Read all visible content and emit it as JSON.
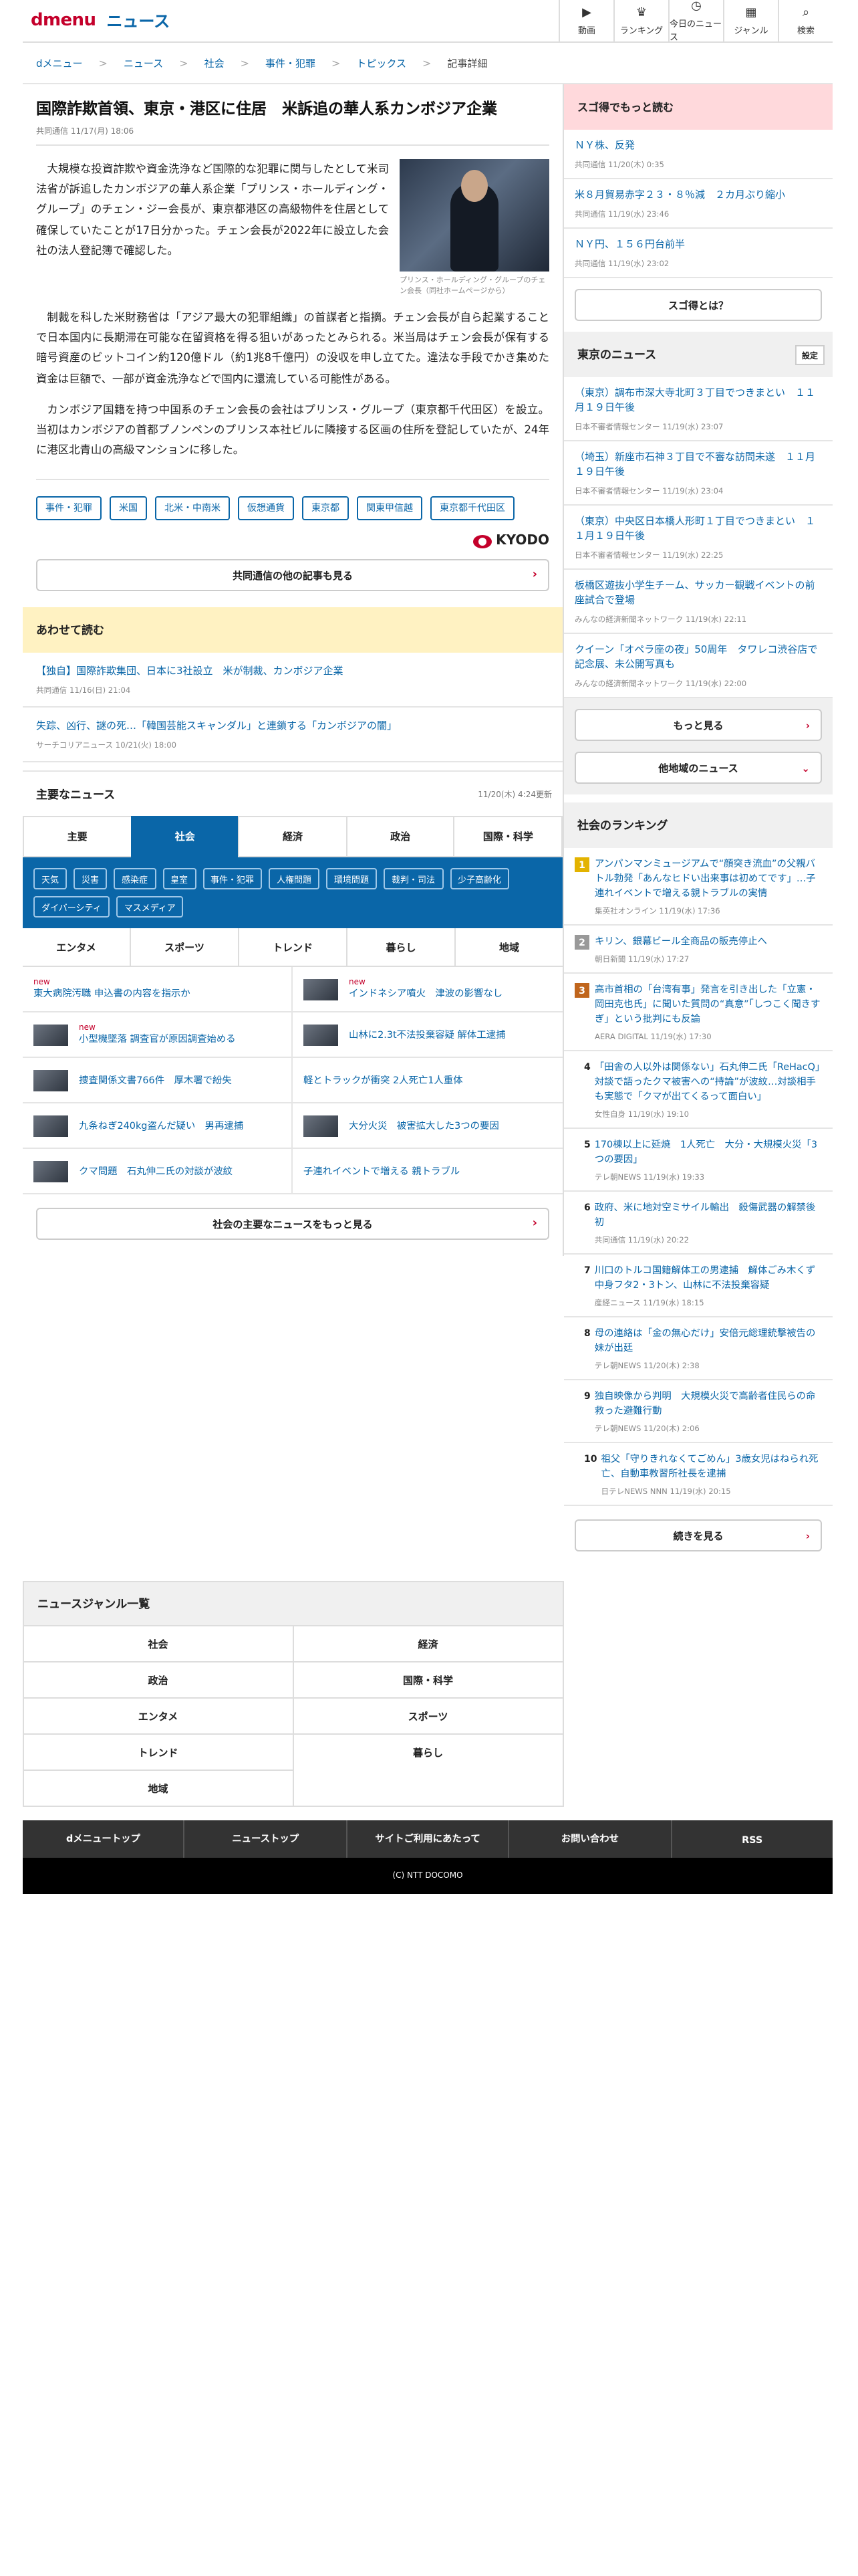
{
  "header": {
    "logo": "dmenu",
    "site": "ニュース",
    "nav": [
      {
        "icon": "▶",
        "label": "動画"
      },
      {
        "icon": "♛",
        "label": "ランキング"
      },
      {
        "icon": "◷",
        "label": "今日のニュース"
      },
      {
        "icon": "▦",
        "label": "ジャンル"
      },
      {
        "icon": "⌕",
        "label": "検索"
      }
    ]
  },
  "breadcrumb": [
    "dメニュー",
    "ニュース",
    "社会",
    "事件・犯罪",
    "トピックス",
    "記事詳細"
  ],
  "article": {
    "title": "国際詐欺首領、東京・港区に住居　米訴追の華人系カンボジア企業",
    "meta": "共同通信 11/17(月) 18:06",
    "p1": "大規模な投資詐欺や資金洗浄など国際的な犯罪に関与したとして米司法省が訴追したカンボジアの華人系企業「プリンス・ホールディング・グループ」のチェン・ジー会長が、東京都港区の高級物件を住居として確保していたことが17日分かった。チェン会長が2022年に設立した会社の法人登記簿で確認した。",
    "caption": "プリンス・ホールディング・グループのチェン会長（同社ホームページから）",
    "p2": "制裁を科した米財務省は「アジア最大の犯罪組織」の首謀者と指摘。チェン会長が自ら起業することで日本国内に長期滞在可能な在留資格を得る狙いがあったとみられる。米当局はチェン会長が保有する暗号資産のビットコイン約120億ドル（約1兆8千億円）の没収を申し立てた。違法な手段でかき集めた資金は巨額で、一部が資金洗浄などで国内に還流している可能性がある。",
    "p3": "カンボジア国籍を持つ中国系のチェン会長の会社はプリンス・グループ（東京都千代田区）を設立。当初はカンボジアの首都プノンペンのプリンス本社ビルに隣接する区画の住所を登記していたが、24年に港区北青山の高級マンションに移した。",
    "tags": [
      "事件・犯罪",
      "米国",
      "北米・中南米",
      "仮想通貨",
      "東京都",
      "関東甲信越",
      "東京都千代田区"
    ],
    "provider": "KYODO",
    "more_btn": "共同通信の他の記事も見る"
  },
  "related": {
    "title": "あわせて読む",
    "items": [
      {
        "t": "【独自】国際詐欺集団、日本に3社設立　米が制裁、カンボジア企業",
        "m": "共同通信 11/16(日) 21:04"
      },
      {
        "t": "失踪、凶行、謎の死…「韓国芸能スキャンダル」と連鎖する「カンボジアの闇」",
        "m": "サーチコリアニュース 10/21(火) 18:00"
      }
    ]
  },
  "mainnews": {
    "title": "主要なニュース",
    "updated": "11/20(木) 4:24更新",
    "tabs": [
      "主要",
      "社会",
      "経済",
      "政治",
      "国際・科学"
    ],
    "subtags": [
      "天気",
      "災害",
      "感染症",
      "皇室",
      "事件・犯罪",
      "人権問題",
      "環境問題",
      "裁判・司法",
      "少子高齢化",
      "ダイバーシティ",
      "マスメディア"
    ],
    "gtabs": [
      "エンタメ",
      "スポーツ",
      "トレンド",
      "暮らし",
      "地域"
    ],
    "items": [
      {
        "t": "東大病院汚職 申込書の内容を指示か",
        "new": "new",
        "th": false
      },
      {
        "t": "インドネシア噴火　津波の影響なし",
        "new": "new",
        "th": true
      },
      {
        "t": "小型機墜落 調査官が原因調査始める",
        "new": "new",
        "th": true
      },
      {
        "t": "山林に2.3t不法投棄容疑 解体工逮捕",
        "new": "",
        "th": true
      },
      {
        "t": "捜査関係文書766件　厚木署で紛失",
        "new": "",
        "th": true
      },
      {
        "t": "軽とトラックが衝突 2人死亡1人重体",
        "new": "",
        "th": false
      },
      {
        "t": "九条ねぎ240kg盗んだ疑い　男再逮捕",
        "new": "",
        "th": true
      },
      {
        "t": "大分火災　被害拡大した3つの要因",
        "new": "",
        "th": true
      },
      {
        "t": "クマ問題　石丸伸二氏の対談が波紋",
        "new": "",
        "th": true
      },
      {
        "t": "子連れイベントで増える 親トラブル",
        "new": "",
        "th": false
      }
    ],
    "more": "社会の主要なニュースをもっと見る"
  },
  "side": {
    "sugo": {
      "title": "スゴ得でもっと読む",
      "items": [
        {
          "t": "ＮＹ株、反発",
          "m": "共同通信 11/20(木) 0:35"
        },
        {
          "t": "米８月貿易赤字２３・８％減　２カ月ぶり縮小",
          "m": "共同通信 11/19(水) 23:46"
        },
        {
          "t": "ＮＹ円、１５６円台前半",
          "m": "共同通信 11/19(水) 23:02"
        }
      ],
      "btn": "スゴ得とは？"
    },
    "tokyo": {
      "title": "東京のニュース",
      "set": "設定",
      "items": [
        {
          "t": "（東京）調布市深大寺北町３丁目でつきまとい　１１月１９日午後",
          "m": "日本不審者情報センター 11/19(水) 23:07"
        },
        {
          "t": "（埼玉）新座市石神３丁目で不審な訪問未遂　１１月１９日午後",
          "m": "日本不審者情報センター 11/19(水) 23:04"
        },
        {
          "t": "（東京）中央区日本橋人形町１丁目でつきまとい　１１月１９日午後",
          "m": "日本不審者情報センター 11/19(水) 22:25"
        },
        {
          "t": "板橋区遊抜小学生チーム、サッカー観戦イベントの前座試合で登場",
          "m": "みんなの経済新聞ネットワーク 11/19(水) 22:11"
        },
        {
          "t": "クイーン「オペラ座の夜」50周年　タワレコ渋谷店で記念展、未公開写真も",
          "m": "みんなの経済新聞ネットワーク 11/19(水) 22:00"
        }
      ],
      "more": "もっと見る",
      "other": "他地域のニュース"
    },
    "ranking": {
      "title": "社会のランキング",
      "items": [
        {
          "n": "1",
          "c": "g",
          "t": "アンパンマンミュージアムで“顔突き流血”の父親バトル勃発「あんなヒドい出来事は初めてです」…子連れイベントで増える親トラブルの実情",
          "m": "集英社オンライン 11/19(水) 17:36"
        },
        {
          "n": "2",
          "c": "s",
          "t": "キリン、銀幕ビール全商品の販売停止へ",
          "m": "朝日新聞 11/19(水) 17:27"
        },
        {
          "n": "3",
          "c": "b",
          "t": "高市首相の「台湾有事」発言を引き出した「立憲・岡田克也氏」に聞いた質問の“真意”「しつこく聞きすぎ」という批判にも反論",
          "m": "AERA DIGITAL 11/19(水) 17:30"
        },
        {
          "n": "4",
          "c": "p",
          "t": "「田舎の人以外は関係ない」石丸伸二氏「ReHacQ」対談で語ったクマ被害への“持論”が波紋…対談相手も実態で「クマが出てくるって面白い」",
          "m": "女性自身 11/19(水) 19:10"
        },
        {
          "n": "5",
          "c": "p",
          "t": "170棟以上に延焼　1人死亡　大分・大規模火災「3つの要因」",
          "m": "テレ朝NEWS 11/19(水) 19:33"
        },
        {
          "n": "6",
          "c": "p",
          "t": "政府、米に地対空ミサイル輸出　殺傷武器の解禁後初",
          "m": "共同通信 11/19(水) 20:22"
        },
        {
          "n": "7",
          "c": "p",
          "t": "川口のトルコ国籍解体工の男逮捕　解体ごみ木くず中身フタ2・3トン、山林に不法投棄容疑",
          "m": "産経ニュース 11/19(水) 18:15"
        },
        {
          "n": "8",
          "c": "p",
          "t": "母の連絡は「金の無心だけ」安倍元総理銃撃被告の妹が出廷",
          "m": "テレ朝NEWS 11/20(木) 2:38"
        },
        {
          "n": "9",
          "c": "p",
          "t": "独自映像から判明　大規模火災で高齢者住民らの命救った避難行動",
          "m": "テレ朝NEWS 11/20(木) 2:06"
        },
        {
          "n": "10",
          "c": "p",
          "t": "祖父「守りきれなくてごめん」3歳女児はねられ死亡、自動車教習所社長を逮捕",
          "m": "日テレNEWS NNN 11/19(水) 20:15"
        }
      ],
      "more": "続きを見る"
    }
  },
  "genre": {
    "title": "ニュースジャンル一覧",
    "items": [
      "社会",
      "経済",
      "政治",
      "国際・科学",
      "エンタメ",
      "スポーツ",
      "トレンド",
      "暮らし",
      "地域"
    ]
  },
  "footer": {
    "nav": [
      "dメニュートップ",
      "ニューストップ",
      "サイトご利用にあたって",
      "お問い合わせ",
      "RSS"
    ],
    "copy": "(C) NTT DOCOMO"
  }
}
